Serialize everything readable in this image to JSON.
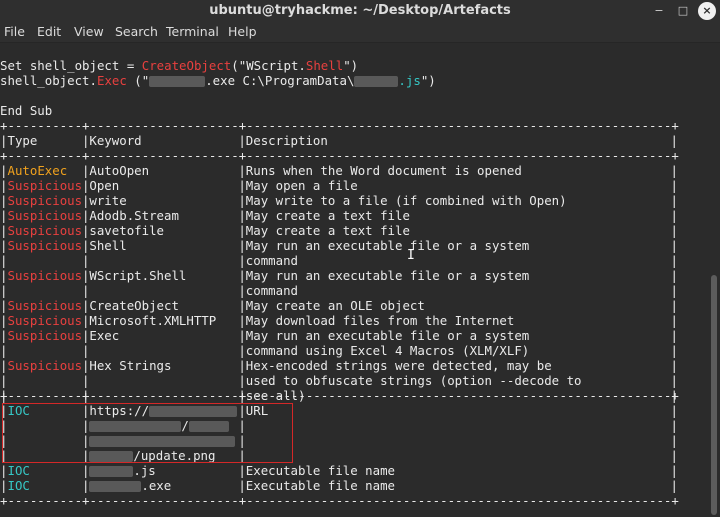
{
  "window": {
    "title": "ubuntu@tryhackme: ~/Desktop/Artefacts",
    "buttons": {
      "minimize": "−",
      "maximize": "□",
      "close": "×"
    }
  },
  "menu": [
    "File",
    "Edit",
    "View",
    "Search",
    "Terminal",
    "Help"
  ],
  "code": {
    "line1": {
      "a": "Set shell_object = ",
      "b": "CreateObject",
      "c": "(\"WScript.",
      "d": "Shell",
      "e": "\")"
    },
    "line2": {
      "a": "shell_object.",
      "b": "Exec",
      "c": " (\"",
      "d": ".exe C:\\ProgramData\\",
      "e": ".js",
      "f": "\")"
    },
    "end": "End Sub"
  },
  "table": {
    "border": "+----------+--------------------+---------------------------------------------------------+",
    "header": [
      "Type",
      "Keyword",
      "Description"
    ],
    "rows": [
      {
        "type": "AutoExec",
        "keyword": "AutoOpen",
        "desc": "Runs when the Word document is opened"
      },
      {
        "type": "Suspicious",
        "keyword": "Open",
        "desc": "May open a file"
      },
      {
        "type": "Suspicious",
        "keyword": "write",
        "desc": "May write to a file (if combined with Open)"
      },
      {
        "type": "Suspicious",
        "keyword": "Adodb.Stream",
        "desc": "May create a text file"
      },
      {
        "type": "Suspicious",
        "keyword": "savetofile",
        "desc": "May create a text file"
      },
      {
        "type": "Suspicious",
        "keyword": "Shell",
        "desc": "May run an executable file or a system"
      },
      {
        "type": "",
        "keyword": "",
        "desc": "command"
      },
      {
        "type": "Suspicious",
        "keyword": "WScript.Shell",
        "desc": "May run an executable file or a system"
      },
      {
        "type": "",
        "keyword": "",
        "desc": "command"
      },
      {
        "type": "Suspicious",
        "keyword": "CreateObject",
        "desc": "May create an OLE object"
      },
      {
        "type": "Suspicious",
        "keyword": "Microsoft.XMLHTTP",
        "desc": "May download files from the Internet"
      },
      {
        "type": "Suspicious",
        "keyword": "Exec",
        "desc": "May run an executable file or a system"
      },
      {
        "type": "",
        "keyword": "",
        "desc": "command using Excel 4 Macros (XLM/XLF)"
      },
      {
        "type": "Suspicious",
        "keyword": "Hex Strings",
        "desc": "Hex-encoded strings were detected, may be"
      },
      {
        "type": "",
        "keyword": "",
        "desc": "used to obfuscate strings (option --decode to"
      },
      {
        "type": "",
        "keyword": "",
        "desc": "see all)"
      }
    ],
    "ioc": {
      "type": "IOC",
      "url_prefix": "https://",
      "url_slash": "/",
      "url_suffix": "/update.png",
      "desc": "URL"
    },
    "ioc_files": [
      {
        "type": "IOC",
        "ext": ".js",
        "desc": "Executable file name"
      },
      {
        "type": "IOC",
        "ext": ".exe",
        "desc": "Executable file name"
      }
    ],
    "cursor_glyph": "I"
  },
  "colors": {
    "suspicious": "#e8403f",
    "autoexec": "#f0a21e",
    "ioc": "#36c7c5",
    "highlight_box": "#d42828"
  }
}
